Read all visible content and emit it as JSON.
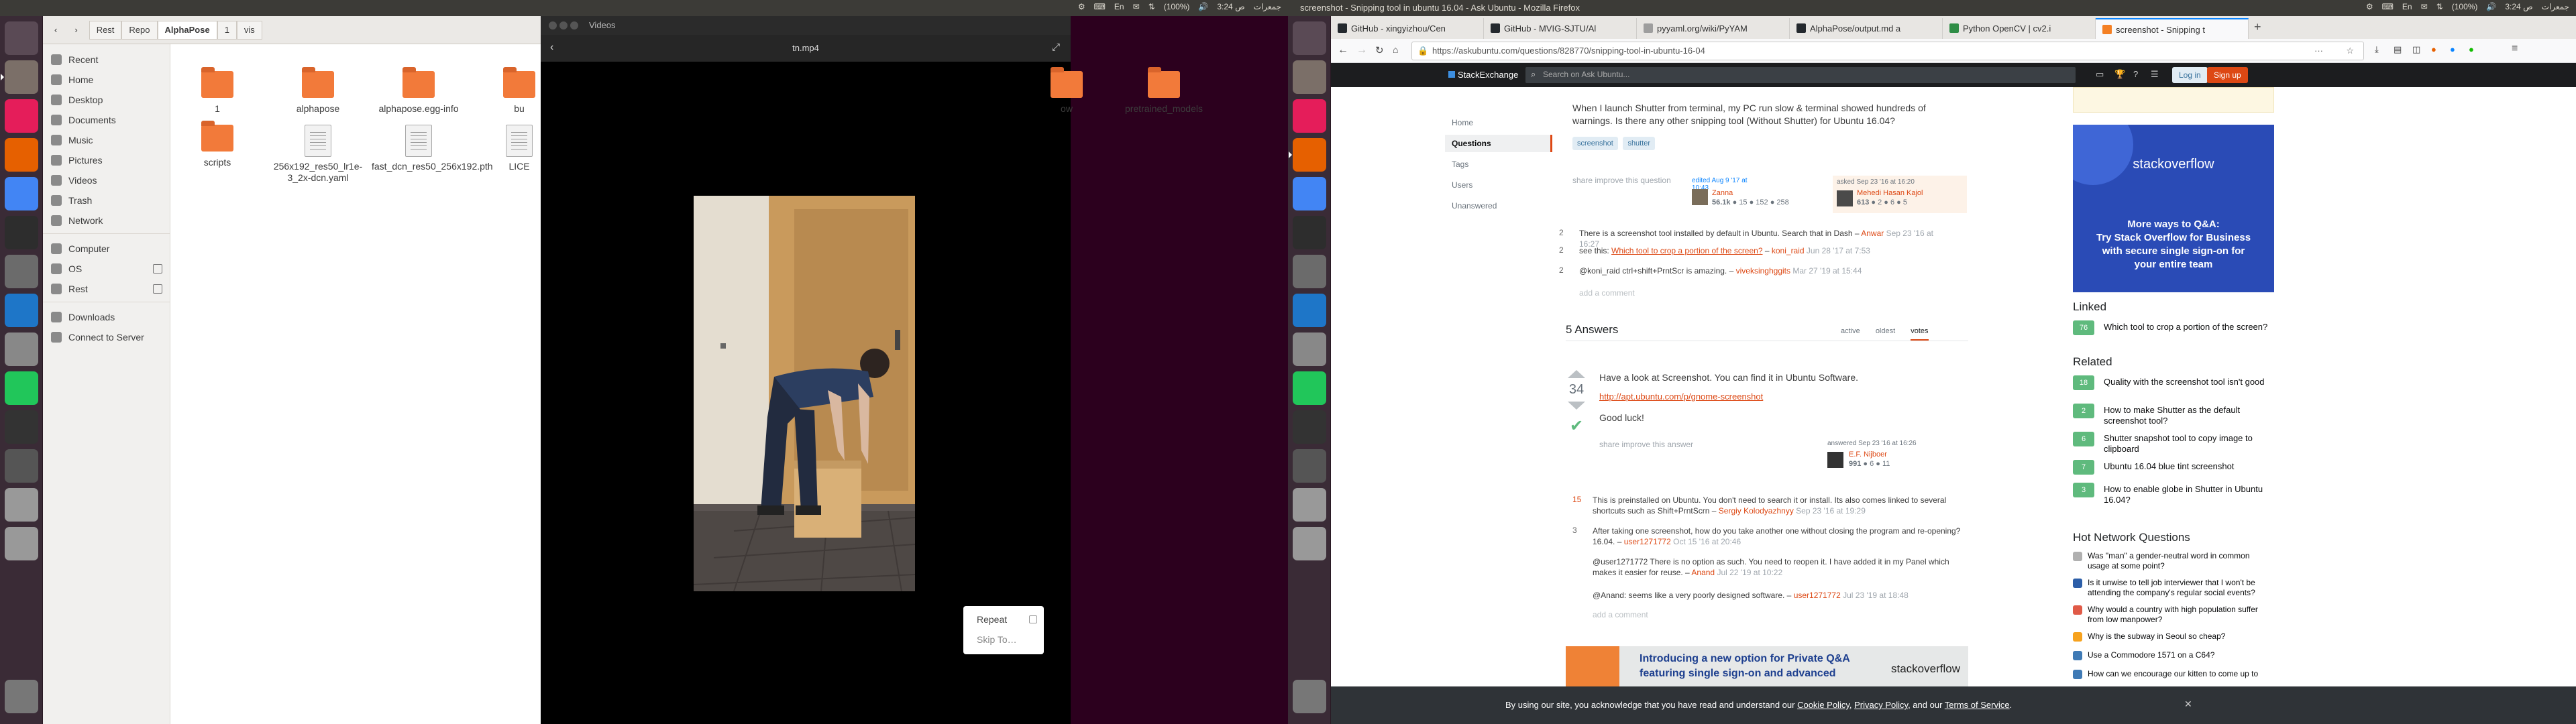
{
  "top_left": {
    "title": "",
    "tray": [
      "⚙",
      "⌨",
      "En",
      "✉",
      "⇅",
      "(100%)",
      "🔊",
      "3:24 ص",
      "جمعرات"
    ]
  },
  "top_right": {
    "title": "screenshot - Snipping tool in ubuntu 16.04 - Ask Ubuntu - Mozilla Firefox",
    "tray": [
      "⚙",
      "⌨",
      "En",
      "✉",
      "⇅",
      "(100%)",
      "🔊",
      "3:24 ص",
      "جمعرات"
    ]
  },
  "launcher_icons": [
    "dash-icon",
    "files-icon",
    "slack-icon",
    "firefox-icon",
    "chrome-icon",
    "terminal-icon",
    "text-editor-icon",
    "vscode-icon",
    "settings-icon",
    "pycharm-icon",
    "videos-icon",
    "clapper-icon",
    "drive-icon",
    "drive-icon",
    "trash-icon"
  ],
  "files": {
    "toolbar": {
      "back": "‹",
      "forward": "›",
      "crumbs": [
        "Rest",
        "Repo",
        "AlphaPose",
        "1",
        "vis"
      ]
    },
    "sidebar": {
      "places": [
        "Recent",
        "Home",
        "Desktop",
        "Documents",
        "Music",
        "Pictures",
        "Videos",
        "Trash",
        "Network"
      ],
      "devices": [
        "Computer",
        "OS",
        "Rest"
      ],
      "extra": [
        "Downloads",
        "Connect to Server"
      ]
    },
    "items": [
      {
        "name": "1",
        "kind": "folder"
      },
      {
        "name": "alphapose",
        "kind": "folder"
      },
      {
        "name": "alphapose.egg-info",
        "kind": "folder"
      },
      {
        "name": "bu",
        "kind": "folder"
      },
      {
        "name": "ow",
        "kind": "folder"
      },
      {
        "name": "pretrained_models",
        "kind": "folder"
      },
      {
        "name": "scripts",
        "kind": "folder"
      },
      {
        "name": "256x192_res50_lr1e-3_2x-dcn.yaml",
        "kind": "doc"
      },
      {
        "name": "fast_dcn_res50_256x192.pth",
        "kind": "doc"
      },
      {
        "name": "LICE",
        "kind": "doc"
      }
    ]
  },
  "player": {
    "window_title": "Videos",
    "filename": "tn.mp4",
    "menu": {
      "repeat": "Repeat",
      "skip": "Skip To…"
    }
  },
  "firefox": {
    "tabs": [
      {
        "label": "GitHub - xingyizhou/Cen",
        "color": "#24292e"
      },
      {
        "label": "GitHub - MVIG-SJTU/Al",
        "color": "#24292e"
      },
      {
        "label": "pyyaml.org/wiki/PyYAM",
        "color": "#9e9e9e"
      },
      {
        "label": "AlphaPose/output.md a",
        "color": "#24292e"
      },
      {
        "label": "Python OpenCV | cv2.i",
        "color": "#2f8d46"
      },
      {
        "label": "screenshot - Snipping t",
        "color": "#f48024"
      }
    ],
    "url": "https://askubuntu.com/questions/828770/snipping-tool-in-ubuntu-16-04"
  },
  "se": {
    "brand": "StackExchange",
    "search_placeholder": "Search on Ask Ubuntu...",
    "login": "Log in",
    "signup": "Sign up",
    "nav": [
      "Home",
      "Questions",
      "Tags",
      "Users",
      "Unanswered"
    ]
  },
  "question": {
    "body": "When I launch Shutter from terminal, my PC run slow & terminal showed hundreds of warnings. Is there any other snipping tool (Without Shutter) for Ubuntu 16.04?",
    "tags": [
      "screenshot",
      "shutter"
    ],
    "actions": "share  improve this question",
    "edited": "edited Aug 9 '17 at 10:43",
    "editor": "Zanna",
    "editor_rep": "56.1k",
    "editor_badges": "● 15 ● 152 ● 258",
    "asked": "asked Sep 23 '16 at 16:20",
    "asker": "Mehedi Hasan Kajol",
    "asker_rep": "613",
    "asker_badges": "● 2 ● 6 ● 5",
    "comments": [
      {
        "score": "2",
        "text": "There is a screenshot tool installed by default in Ubuntu. Search that in Dash –",
        "user": "Anwar",
        "date": "Sep 23 '16 at 16:27"
      },
      {
        "score": "2",
        "text": "see this:",
        "link": "Which tool to crop a portion of the screen?",
        "after": " –",
        "user": "koni_raid",
        "date": "Jun 28 '17 at 7:53"
      },
      {
        "score": "2",
        "text": "@koni_raid ctrl+shift+PrntScr is amazing. –",
        "user": "viveksinghggits",
        "date": "Mar 27 '19 at 15:44"
      }
    ],
    "add_comment": "add a comment"
  },
  "answers": {
    "count": "5 Answers",
    "sort": [
      "active",
      "oldest",
      "votes"
    ],
    "top": {
      "votes": "34",
      "line1": "Have a look at Screenshot. You can find it in Ubuntu Software.",
      "link": "http://apt.ubuntu.com/p/gnome-screenshot",
      "line2": "Good luck!",
      "actions": "share  improve this answer",
      "answered": "answered Sep 23 '16 at 16:26",
      "user": "E.F. Nijboer",
      "rep": "991",
      "badges": "● 6 ● 11"
    },
    "comments": [
      {
        "score": "15",
        "text": "This is preinstalled on Ubuntu. You don't need to search it or install. Its also comes linked to several shortcuts such as Shift+PrntScrn –",
        "user": "Sergiy Kolodyazhnyy",
        "date": "Sep 23 '16 at 19:29"
      },
      {
        "score": "3",
        "text": "After taking one screenshot, how do you take another one without closing the program and re-opening? 16.04. –",
        "user": "user1271772",
        "date": "Oct 15 '16 at 20:46"
      },
      {
        "score": "",
        "text": "@user1271772 There is no option as such. You need to reopen it. I have added it in my Panel which makes it easier for reuse. –",
        "user": "Anand",
        "date": "Jul 22 '19 at 10:22"
      },
      {
        "score": "",
        "text": "@Anand: seems like a very poorly designed software. –",
        "user": "user1271772",
        "date": "Jul 23 '19 at 18:48"
      }
    ],
    "add_comment": "add a comment"
  },
  "banner": {
    "line1": "Introducing a new option for Private Q&A",
    "line2": "featuring single sign-on and advanced",
    "brand": "stackoverflow"
  },
  "ad": {
    "brand": "stackoverflow",
    "line1": "More ways to Q&A:",
    "line2": "Try Stack Overflow for Business",
    "line3": "with secure single sign-on for",
    "line4": "your entire team"
  },
  "linked": {
    "title": "Linked",
    "items": [
      {
        "votes": "76",
        "text": "Which tool to crop a portion of the screen?"
      }
    ]
  },
  "related": {
    "title": "Related",
    "items": [
      {
        "votes": "18",
        "text": "Quality with the screenshot tool isn't good"
      },
      {
        "votes": "2",
        "text": "How to make Shutter as the default screenshot tool?"
      },
      {
        "votes": "6",
        "text": "Shutter snapshot tool to copy image to clipboard"
      },
      {
        "votes": "7",
        "text": "Ubuntu 16.04 blue tint screenshot"
      },
      {
        "votes": "3",
        "text": "How to enable globe in Shutter in Ubuntu 16.04?"
      }
    ]
  },
  "hnq": {
    "title": "Hot Network Questions",
    "items": [
      {
        "text": "Was \"man\" a gender-neutral word in common usage at some point?",
        "color": "#b0b0b0"
      },
      {
        "text": "Is it unwise to tell job interviewer that I won't be attending the company's regular social events?",
        "color": "#2c5ea8"
      },
      {
        "text": "Why would a country with high population suffer from low manpower?",
        "color": "#e05a47"
      },
      {
        "text": "Why is the subway in Seoul so cheap?",
        "color": "#f6a21e"
      },
      {
        "text": "Use a Commodore 1571 on a C64?",
        "color": "#3f7ab5"
      },
      {
        "text": "How can we encourage our kitten to come up to",
        "color": "#3f7ab5"
      }
    ]
  },
  "cookie": {
    "pre": "By using our site, you acknowledge that you have read and understand our",
    "l1": "Cookie Policy",
    "sep1": ",",
    "l2": "Privacy Policy",
    "sep2": ", and our",
    "l3": "Terms of Service",
    "end": ".",
    "close": "✕"
  }
}
